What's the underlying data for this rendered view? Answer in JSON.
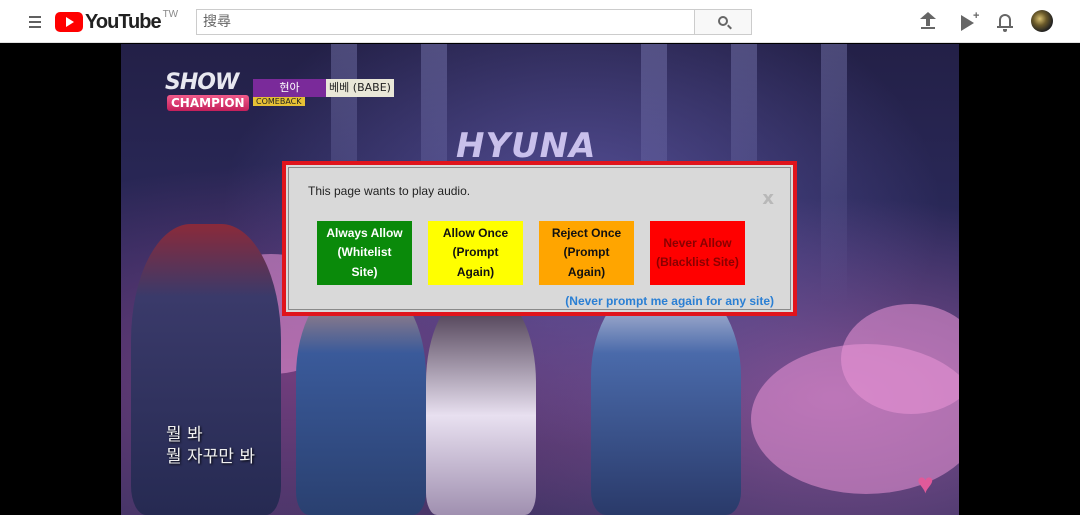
{
  "header": {
    "logo_text": "YouTube",
    "logo_region": "TW",
    "search": {
      "placeholder": "搜尋",
      "value": ""
    },
    "icons": [
      "menu-icon",
      "search-icon",
      "upload-icon",
      "create-video-icon",
      "notifications-bell-icon",
      "account-avatar"
    ]
  },
  "video": {
    "overlay": {
      "show_logo_top": "SHOW",
      "show_logo_bottom": "CHAMPION",
      "artist": "현아",
      "song_title": "베베 (BABE)",
      "comeback_tag": "COMEBACK",
      "stage_sign": "HYUNA"
    },
    "subtitles": [
      "뭘 봐",
      "뭘 자꾸만 봐"
    ]
  },
  "dialog": {
    "message": "This page wants to play audio.",
    "close_label": "x",
    "buttons": {
      "always_allow": "Always Allow (Whitelist Site)",
      "allow_once": "Allow Once (Prompt Again)",
      "reject_once": "Reject Once (Prompt Again)",
      "never_allow": "Never Allow (Blacklist Site)"
    },
    "never_prompt_link": "(Never prompt me again for any site)",
    "colors": {
      "border": "#e0141c",
      "background": "#d9d9d9",
      "always_allow": "#0a8a0a",
      "allow_once": "#ffff00",
      "reject_once": "#ffa500",
      "never_allow": "#ff0000",
      "link": "#2a7fd4"
    }
  }
}
